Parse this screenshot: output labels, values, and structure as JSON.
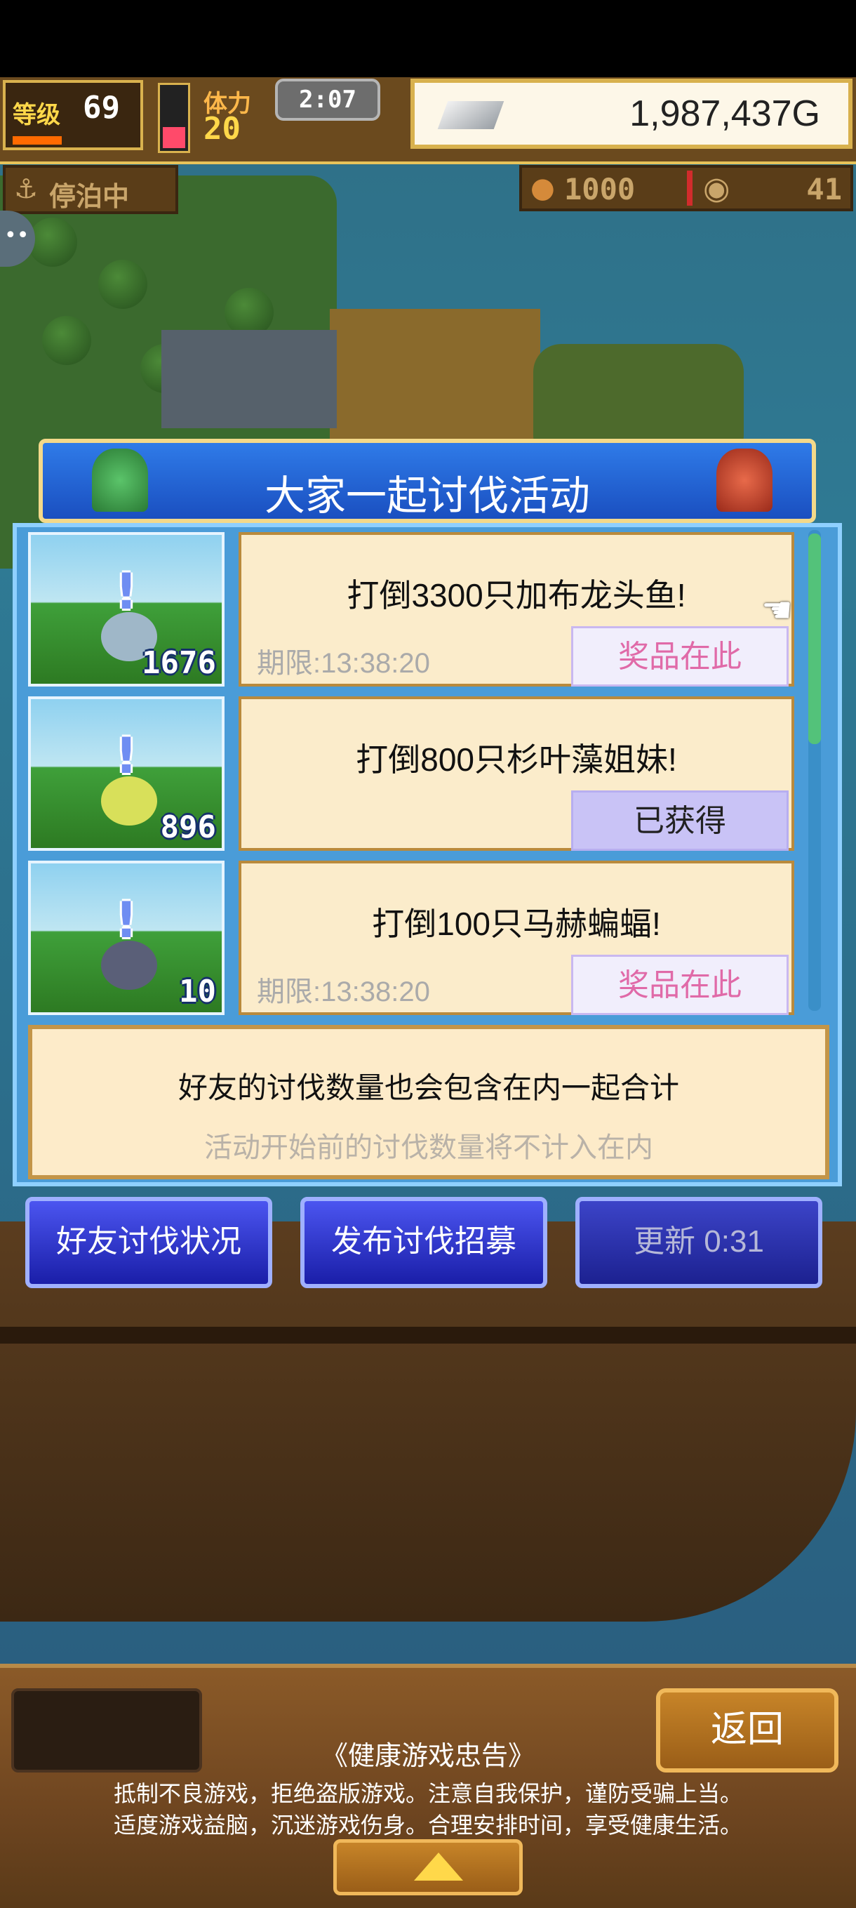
{
  "hud": {
    "level_label": "等级",
    "level_value": "69",
    "stamina_label": "体力",
    "stamina_value": "20",
    "timer": "2:07",
    "gold": "1,987,437G",
    "status": "停泊中",
    "food": "1000",
    "coins": "41"
  },
  "panel": {
    "title": "大家一起讨伐活动",
    "quests": [
      {
        "title": "打倒3300只加布龙头鱼!",
        "limit": "期限:13:38:20",
        "button": "奖品在此",
        "count": "1676",
        "monster_color": "#9fb7c8"
      },
      {
        "title": "打倒800只杉叶藻姐妹!",
        "limit": "",
        "button": "已获得",
        "count": "896",
        "monster_color": "#d8e05a"
      },
      {
        "title": "打倒100只马赫蝙蝠!",
        "limit": "期限:13:38:20",
        "button": "奖品在此",
        "count": "10",
        "monster_color": "#5a5f78"
      }
    ],
    "note_main": "好友的讨伐数量也会包含在内一起合计",
    "note_sub": "活动开始前的讨伐数量将不计入在内"
  },
  "actions": {
    "friend_status": "好友讨伐状况",
    "post_recruit": "发布讨伐招募",
    "refresh": "更新 0:31"
  },
  "footer": {
    "back": "返回",
    "advisory_title": "《健康游戏忠告》",
    "advisory_line1": "抵制不良游戏，拒绝盗版游戏。注意自我保护，谨防受骗上当。",
    "advisory_line2": "适度游戏益脑，沉迷游戏伤身。合理安排时间，享受健康生活。"
  }
}
